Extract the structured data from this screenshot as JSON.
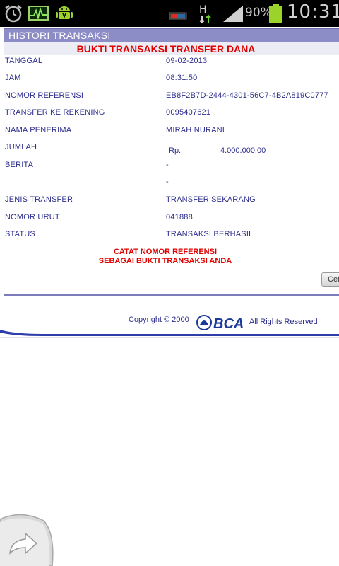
{
  "status_bar": {
    "battery_percent": "90%",
    "time": "10:31",
    "network": "H",
    "icons": [
      "alarm-icon",
      "monitor-icon",
      "android-icon",
      "battery-mini-icon",
      "h-data-icon",
      "signal-icon",
      "battery-icon"
    ]
  },
  "page": {
    "header_title": "HISTORI TRANSAKSI",
    "subtitle": "BUKTI TRANSAKSI TRANSFER DANA"
  },
  "rows": [
    {
      "label": "TANGGAL",
      "value": "09-02-2013"
    },
    {
      "label": "JAM",
      "value": "08:31:50"
    },
    {
      "label": "NOMOR REFERENSI",
      "value": "EB8F2B7D-2444-4301-56C7-4B2A819C0777"
    },
    {
      "label": "TRANSFER KE REKENING",
      "value": "0095407621"
    },
    {
      "label": "NAMA PENERIMA",
      "value": "MIRAH NURANI"
    },
    {
      "label": "JUMLAH",
      "currency": "Rp.",
      "amount": "4.000.000,00"
    },
    {
      "label": "BERITA",
      "value": "-"
    },
    {
      "label": "",
      "value": "-"
    },
    {
      "label": "JENIS TRANSFER",
      "value": "TRANSFER SEKARANG"
    },
    {
      "label": "NOMOR URUT",
      "value": "041888"
    },
    {
      "label": "STATUS",
      "value": "TRANSAKSI BERHASIL"
    }
  ],
  "colon": ":",
  "note": {
    "line1": "CATAT NOMOR REFERENSI",
    "line2": "SEBAGAI BUKTI TRANSAKSI ANDA"
  },
  "buttons": {
    "cetak_label": "Cetak"
  },
  "footer": {
    "copyright": "Copyright © 2000",
    "brand": "BCA",
    "rights": "All Rights Reserved"
  },
  "colors": {
    "header_bg": "#8c8cc6",
    "label_text": "#2e2e8e",
    "alert_red": "#e00000"
  }
}
